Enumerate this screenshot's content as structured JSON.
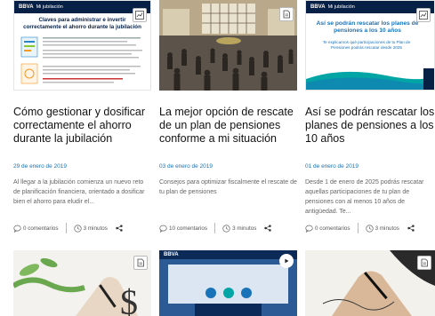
{
  "cards": [
    {
      "brand": "BBVA",
      "section": "Mi jubilación",
      "thumb_heading": "Claves para administrar e invertir correctamente el ahorro durante la jubilación",
      "title": "Cómo gestionar y dosificar correctamente el ahorro durante la jubilación",
      "date": "29 de enero de 2019",
      "summary": "Al llegar a la jubilación comienza un nuevo reto de planificación financiera, orientado a dosificar bien el ahorro para eludir el...",
      "comments": "0 comentarios",
      "read_time": "3 minutos",
      "badge_icon": "chart-icon"
    },
    {
      "title": "La mejor opción de rescate de un plan de pensiones conforme a mi situación",
      "date": "03 de enero de 2019",
      "summary": "Consejos para optimizar fiscalmente el rescate de tu plan de pensiones",
      "comments": "10 comentarios",
      "read_time": "3 minutos",
      "badge_icon": "document-icon"
    },
    {
      "brand": "BBVA",
      "section": "Mi jubilación",
      "thumb_heading": "Así se podrán rescatar los planes de pensiones a los 10 años",
      "thumb_sub": "Te explicamos qué participaciones de tu Plan de Pensiones podrás rescatar desde 2025",
      "title": "Así se podrán rescatar los planes de pensiones a los 10 años",
      "date": "01 de enero de 2019",
      "summary": "Desde 1 de enero de 2025 podrás rescatar aquellas participaciones de tu plan de pensiones con al menos 10 años de antigüedad. Te...",
      "comments": "0 comentarios",
      "read_time": "3 minutos",
      "badge_icon": "chart-icon"
    }
  ],
  "row2": [
    {
      "badge_icon": "document-icon"
    },
    {
      "brand": "BBVA",
      "badge_icon": "play-icon"
    },
    {
      "badge_icon": "document-icon"
    }
  ],
  "colors": {
    "date_blue": "#1973b8",
    "bbva_navy": "#072146",
    "accent_teal": "#02a5a5"
  }
}
